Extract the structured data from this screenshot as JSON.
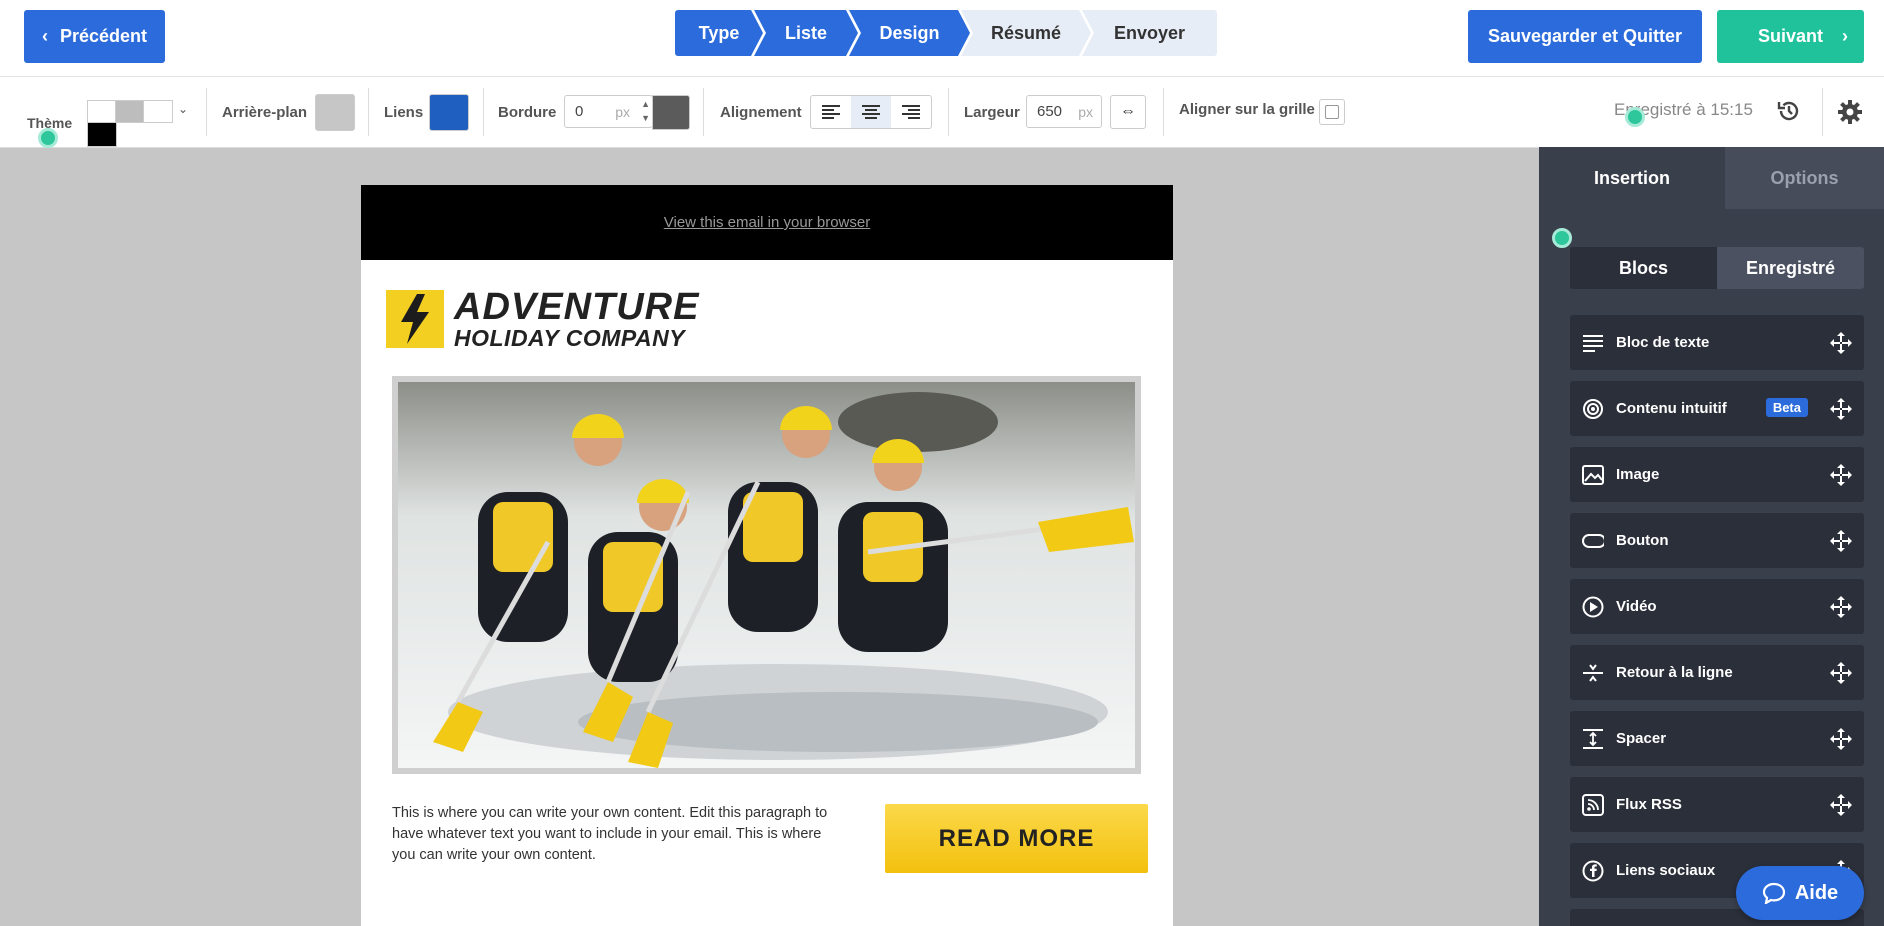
{
  "topbar": {
    "prev_label": "Précédent",
    "steps": [
      {
        "label": "Type"
      },
      {
        "label": "Liste"
      },
      {
        "label": "Design"
      },
      {
        "label": "Résumé"
      },
      {
        "label": "Envoyer"
      }
    ],
    "active_step": "Design",
    "save_label": "Sauvegarder et Quitter",
    "next_label": "Suivant"
  },
  "toolbar": {
    "theme_label": "Thème",
    "background_label": "Arrière-plan",
    "background_color": "#c6c6c6",
    "links_label": "Liens",
    "links_color": "#1e5fbf",
    "border_label": "Bordure",
    "border_value": "0",
    "border_unit": "px",
    "border_color": "#5b5b5b",
    "alignment_label": "Alignement",
    "alignment_selected": "center",
    "width_label": "Largeur",
    "width_value": "650",
    "width_unit": "px",
    "grid_label": "Aligner sur la grille",
    "grid_checked": false,
    "saved_status": "Enregistré à 15:15"
  },
  "email": {
    "browser_link": "View this email in your browser",
    "logo_line1": "ADVENTURE",
    "logo_line2": "HOLIDAY COMPANY",
    "body_text": "This is where you can write your own content. Edit this paragraph to have whatever text you want to include in your email. This is where you can write your own content.",
    "button_label": "READ MORE"
  },
  "panel": {
    "tabs": {
      "insertion": "Insertion",
      "options": "Options"
    },
    "segments": {
      "blocks": "Blocs",
      "saved": "Enregistré"
    },
    "blocks": [
      {
        "label": "Bloc de texte",
        "icon": "text-lines-icon"
      },
      {
        "label": "Contenu intuitif",
        "icon": "target-icon",
        "badge": "Beta"
      },
      {
        "label": "Image",
        "icon": "image-icon"
      },
      {
        "label": "Bouton",
        "icon": "button-shape-icon"
      },
      {
        "label": "Vidéo",
        "icon": "play-icon"
      },
      {
        "label": "Retour à la ligne",
        "icon": "divider-icon"
      },
      {
        "label": "Spacer",
        "icon": "spacer-icon"
      },
      {
        "label": "Flux RSS",
        "icon": "rss-icon"
      },
      {
        "label": "Liens sociaux",
        "icon": "facebook-icon"
      }
    ]
  },
  "help": {
    "label": "Aide"
  },
  "colors": {
    "primary": "#2c6bdb",
    "success": "#1fc29b",
    "panel_bg": "#3a3f4c",
    "block_bg": "#2b2f3a",
    "accent_yellow": "#f3c00e"
  }
}
